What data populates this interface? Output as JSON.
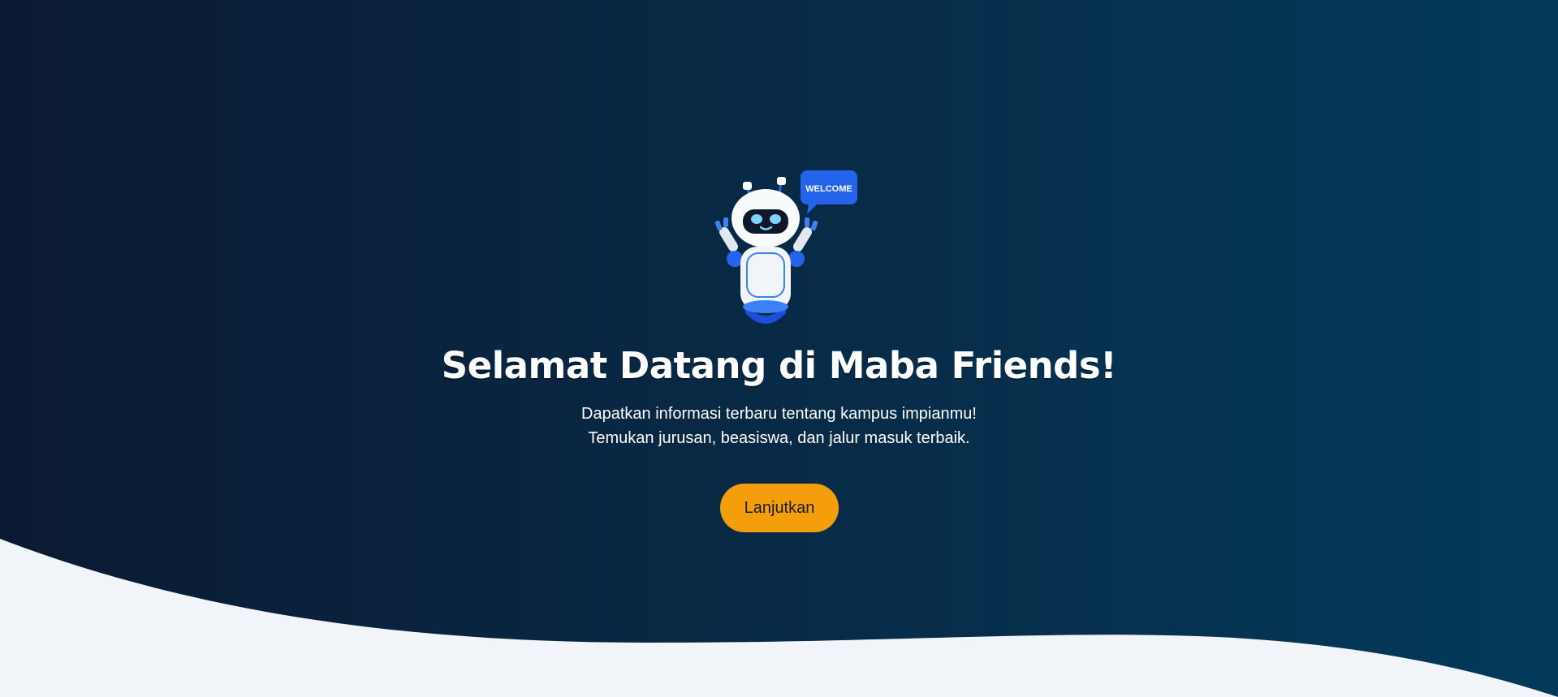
{
  "hero": {
    "robot": {
      "icon": "robot-mascot-icon",
      "speech_bubble_text": "WELCOME"
    },
    "title": "Selamat Datang di Maba Friends!",
    "subtitle_line1": "Dapatkan informasi terbaru tentang kampus impianmu!",
    "subtitle_line2": "Temukan jurusan, beasiswa, dan jalur masuk terbaik.",
    "cta_label": "Lanjutkan"
  },
  "colors": {
    "background_start": "#0b1a33",
    "background_end": "#033a5a",
    "wave": "#f1f5f9",
    "cta": "#f59e0b",
    "robot_accent": "#2563eb"
  }
}
